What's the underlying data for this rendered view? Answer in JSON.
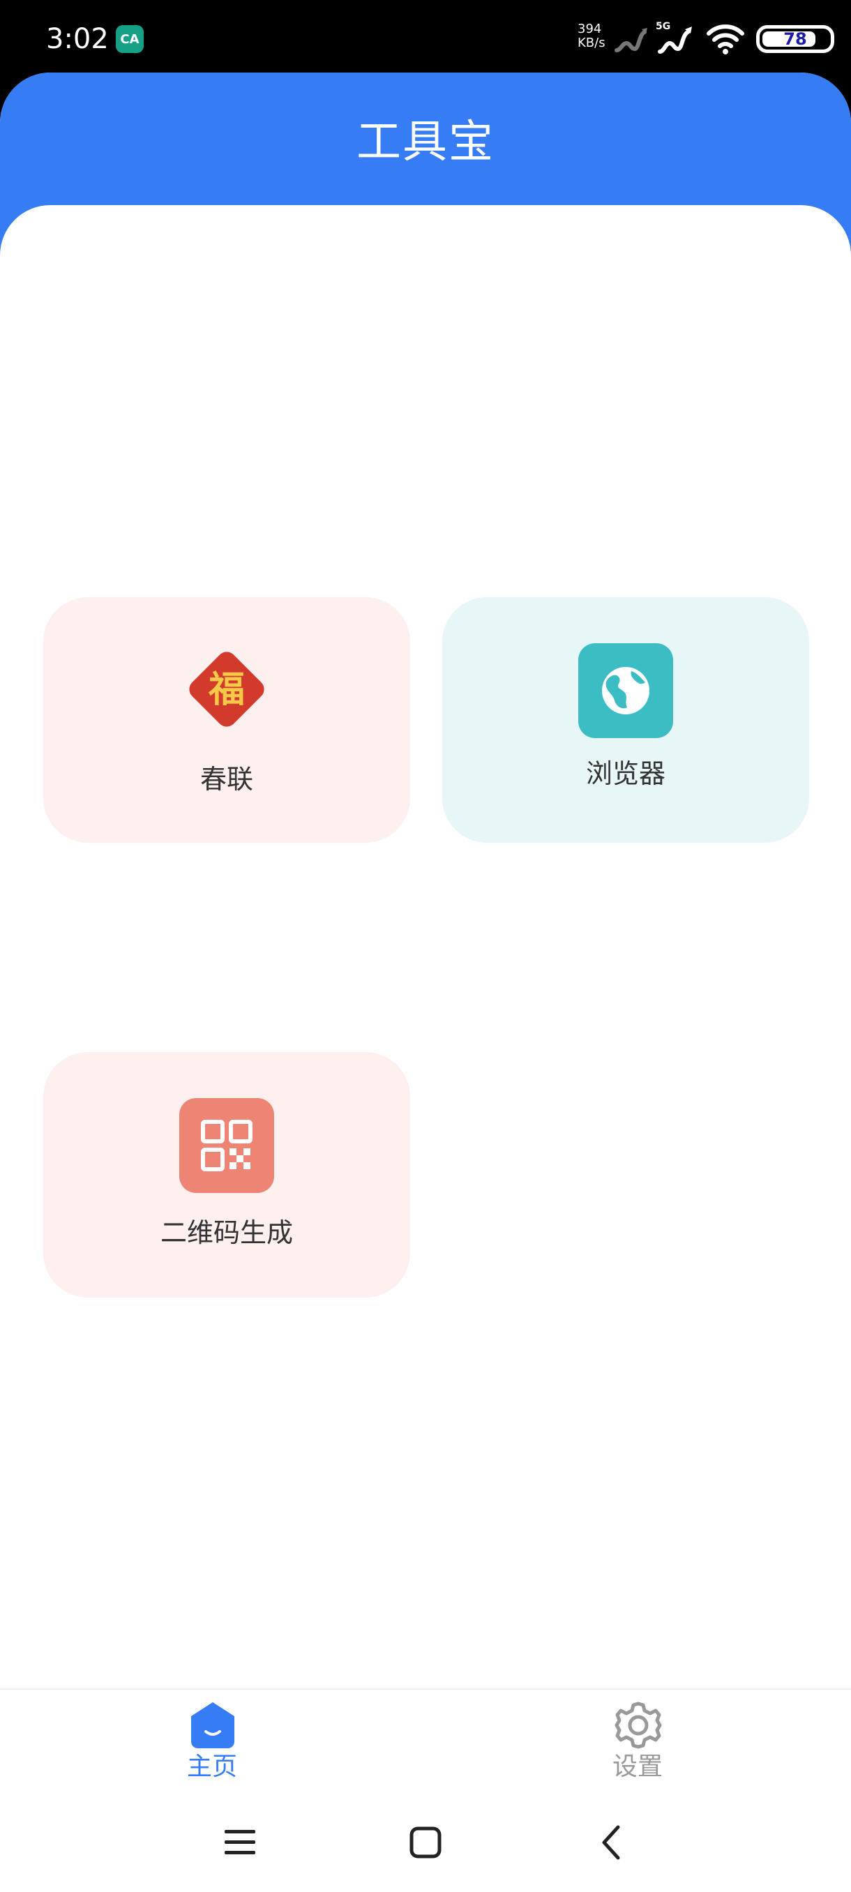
{
  "status_bar": {
    "time": "3:02",
    "app_badge": "CA",
    "net_speed_value": "394",
    "net_speed_unit": "KB/s",
    "network_type": "5G",
    "battery": "78"
  },
  "header": {
    "title": "工具宝"
  },
  "tools": [
    {
      "label": "春联",
      "icon": "fu-diamond-icon",
      "glyph": "福",
      "color": "#d23a2c"
    },
    {
      "label": "浏览器",
      "icon": "globe-icon",
      "color": "#3cbdc4"
    },
    {
      "label": "二维码生成",
      "icon": "qr-code-icon",
      "color": "#ee8473"
    }
  ],
  "bottom_nav": {
    "items": [
      {
        "label": "主页",
        "icon": "home-icon",
        "active": true
      },
      {
        "label": "设置",
        "icon": "gear-icon",
        "active": false
      }
    ],
    "active_color": "#367cf4",
    "inactive_color": "#999999"
  },
  "theme": {
    "primary": "#367cf4",
    "card_pink": "#fdf0ef",
    "card_cyan": "#e7f6f7"
  }
}
